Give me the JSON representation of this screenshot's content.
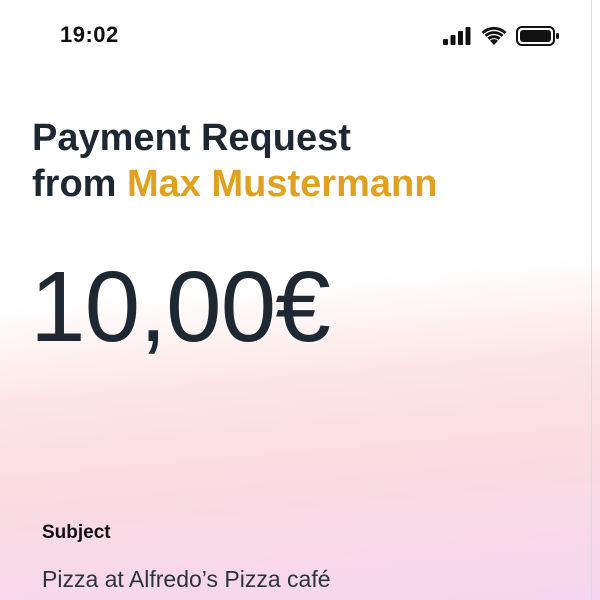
{
  "status_bar": {
    "time": "19:02",
    "icons": [
      "cellular-signal-icon",
      "wifi-icon",
      "battery-icon"
    ]
  },
  "request": {
    "title_line1": "Payment Request",
    "title_from": "from",
    "sender_name": "Max Mustermann",
    "amount": "10,00€",
    "subject_label": "Subject",
    "subject_value": "Pizza at Alfredo’s Pizza café"
  },
  "colors": {
    "accent": "#e0a020",
    "text": "#1e2832",
    "gradient_pink": "#f6d6ee"
  }
}
